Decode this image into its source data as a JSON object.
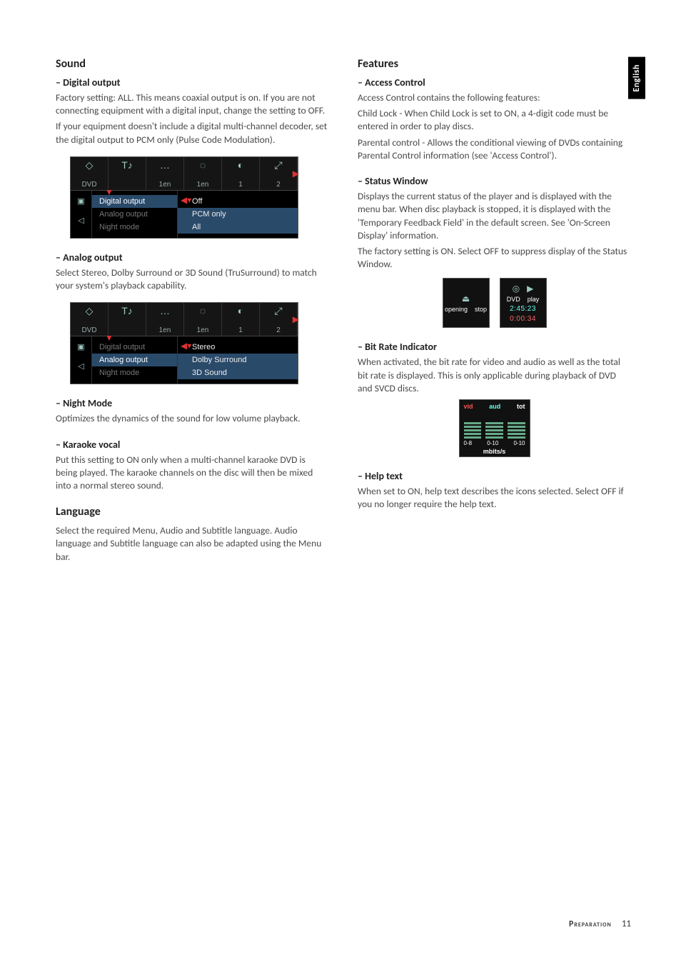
{
  "langtab": "English",
  "footer": {
    "label": "Preparation",
    "page": "11"
  },
  "left": {
    "h_sound": "Sound",
    "digital_output": {
      "title": "Digital output",
      "p1": "Factory setting: ALL. This means coaxial output is on. If you are not connecting equipment with a digital input, change the setting to OFF.",
      "p2": "If your equipment doesn't include a digital multi-channel decoder, set the digital output to PCM only (Pulse Code Modulation)."
    },
    "analog_output": {
      "title": "Analog output",
      "p": "Select Stereo, Dolby Surround or 3D Sound (TruSurround) to match your system's playback capability."
    },
    "night_mode": {
      "title": "Night Mode",
      "p": "Optimizes the dynamics of the sound for low volume playback."
    },
    "karaoke": {
      "title": "Karaoke vocal",
      "p": "Put this setting to ON only when a multi-channel karaoke DVD is being played. The karaoke channels on the disc will then be mixed into a normal stereo sound."
    },
    "h_language": "Language",
    "language_p": "Select the required Menu, Audio and Subtitle language. Audio language and Subtitle language can also be adapted using the Menu bar."
  },
  "right": {
    "h_features": "Features",
    "access": {
      "title": "Access Control",
      "p1": "Access Control contains the following features:",
      "p2": "Child Lock - When Child Lock is set to ON, a 4-digit code must be entered in order to play discs.",
      "p3": "Parental control - Allows the conditional viewing of DVDs containing Parental Control information (see 'Access Control')."
    },
    "status": {
      "title": "Status Window",
      "p1": "Displays the current status of the player and is displayed with the menu bar.  When disc playback is stopped, it is displayed with the 'Temporary Feedback Field' in the default screen. See 'On-Screen Display' information.",
      "p2": "The factory setting is ON. Select OFF to suppress display of the Status Window."
    },
    "bitrate": {
      "title": "Bit Rate Indicator",
      "p": "When activated, the bit rate for video and audio as well as the total bit rate is displayed. This is only applicable during playback of DVD and SVCD discs."
    },
    "help": {
      "title": "Help text",
      "p": "When set to ON, help text describes the icons selected. Select OFF if you no longer require the help text."
    }
  },
  "osd1": {
    "tabs": [
      "1en",
      "1en",
      "1",
      "2"
    ],
    "menu": [
      "Digital output",
      "Analog output",
      "Night mode"
    ],
    "menu_hl": 0,
    "options": [
      "Off",
      "PCM only",
      "All"
    ],
    "opt_hl": 0
  },
  "osd2": {
    "tabs": [
      "1en",
      "1en",
      "1",
      "2"
    ],
    "menu": [
      "Digital output",
      "Analog output",
      "Night mode"
    ],
    "menu_hl": 1,
    "options": [
      "Stereo",
      "Dolby Surround",
      "3D Sound"
    ],
    "opt_hl": 0
  },
  "status_img": {
    "left": {
      "top": "opening",
      "sub": "stop"
    },
    "right": {
      "type": "DVD",
      "label": "play",
      "t1": "2:45:23",
      "t2": "0:00:34"
    }
  },
  "bitrate_img": {
    "cols": [
      "vid",
      "aud",
      "tot"
    ],
    "foot": [
      "0-8",
      "0-10",
      "0-10"
    ],
    "unit": "mbits/s"
  }
}
